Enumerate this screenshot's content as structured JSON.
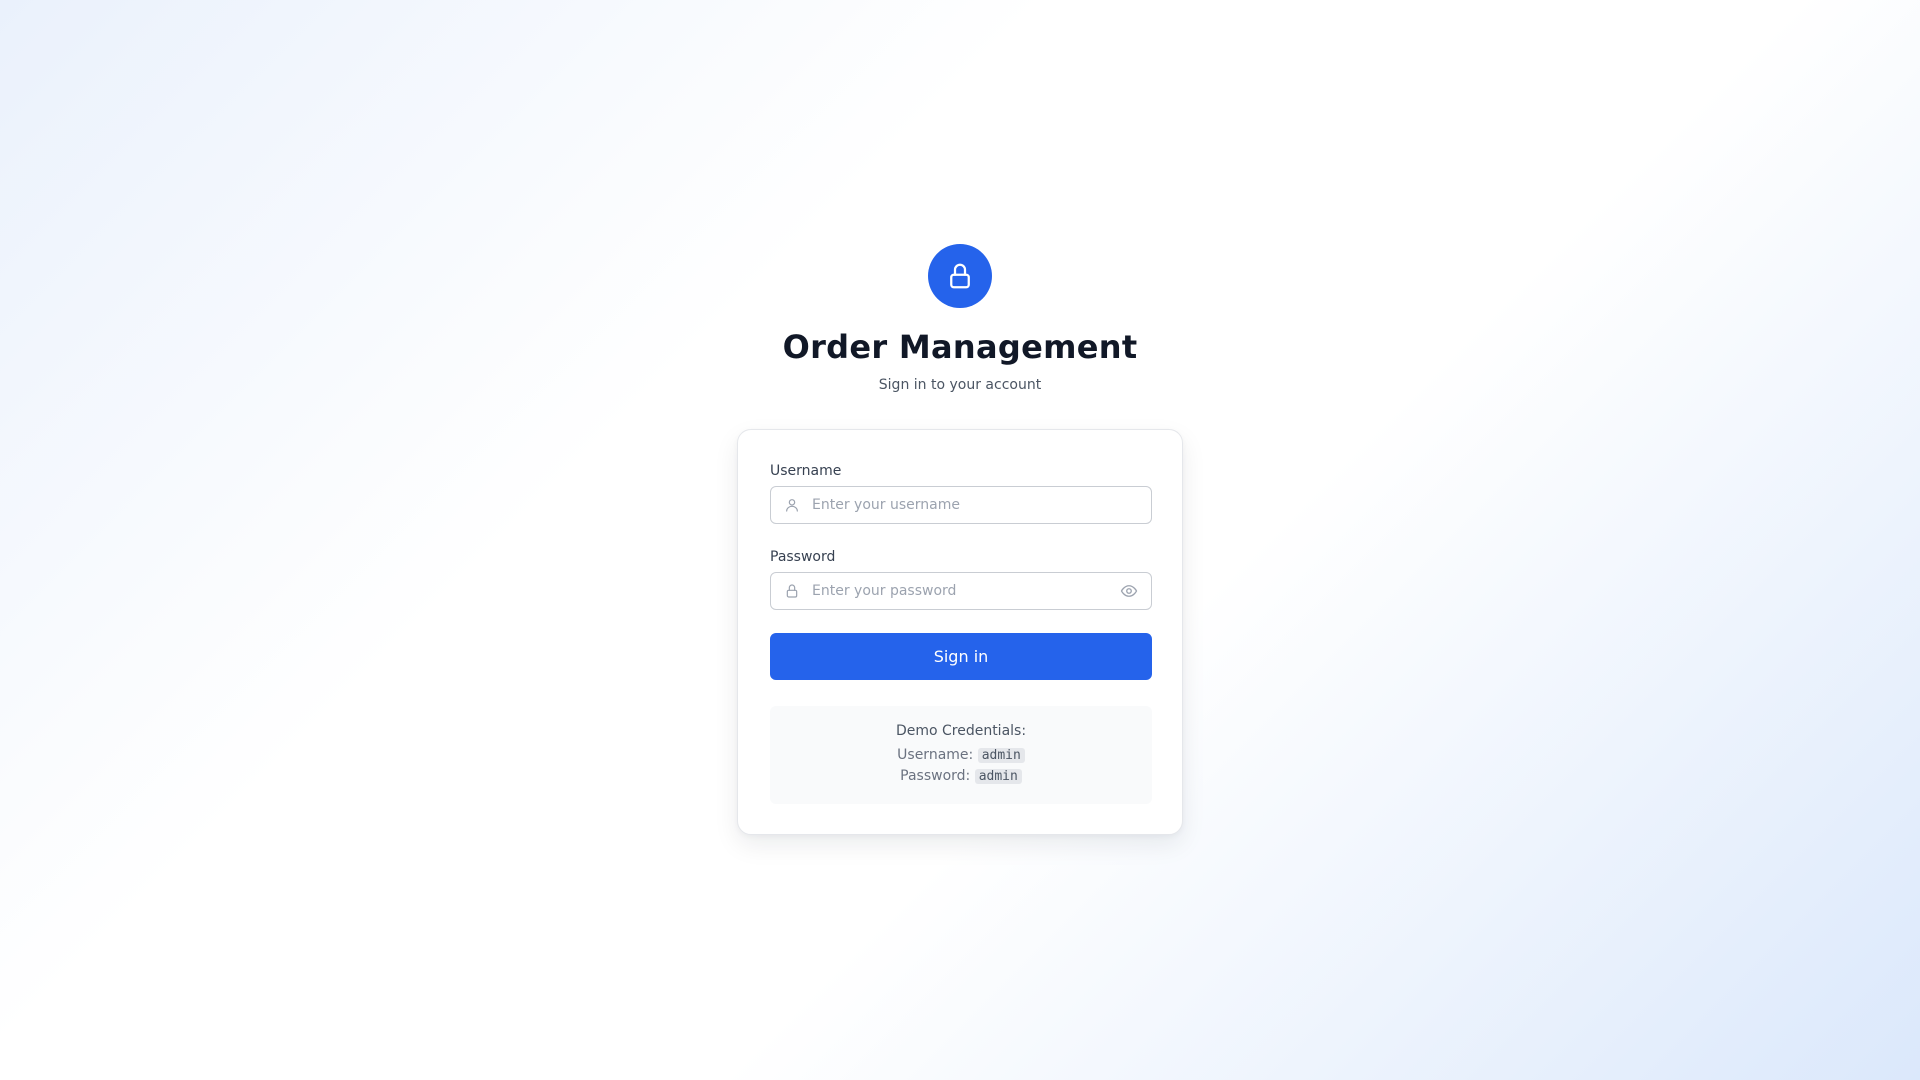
{
  "app": {
    "title": "Order Management",
    "subtitle": "Sign in to your account"
  },
  "form": {
    "username": {
      "label": "Username",
      "placeholder": "Enter your username",
      "value": "",
      "icon": "user-icon"
    },
    "password": {
      "label": "Password",
      "placeholder": "Enter your password",
      "value": "",
      "icon": "lock-icon",
      "toggle_icon": "eye-icon"
    },
    "submit_label": "Sign in"
  },
  "demo": {
    "title": "Demo Credentials:",
    "username_label": "Username:",
    "username_value": "admin",
    "password_label": "Password:",
    "password_value": "admin"
  },
  "colors": {
    "accent": "#2563eb",
    "title_text": "#111827",
    "muted_text": "#4b5563",
    "input_border": "#c9cdd3",
    "demo_bg": "#f9fafb"
  },
  "icons": {
    "logo": "lock-icon"
  }
}
